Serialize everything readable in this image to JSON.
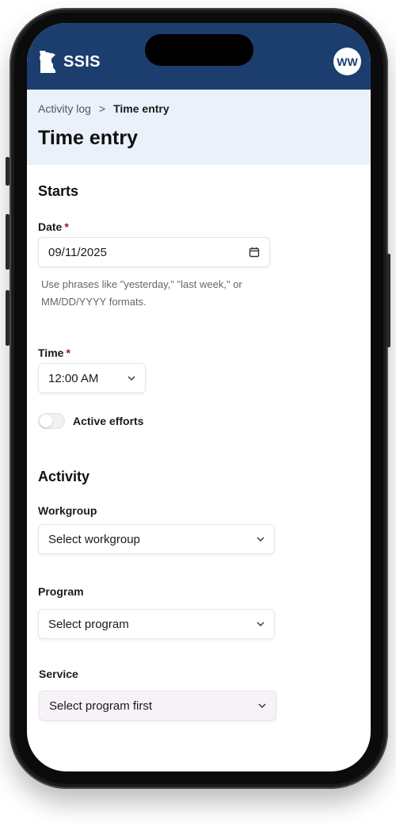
{
  "app": {
    "brand": "SSIS",
    "avatar_initials": "WW",
    "header_color": "#1c3e6e"
  },
  "breadcrumb": {
    "parent": "Activity log",
    "separator": ">",
    "current": "Time entry"
  },
  "page": {
    "title": "Time entry"
  },
  "starts": {
    "title": "Starts",
    "date": {
      "label": "Date",
      "required_mark": "*",
      "value": "09/11/2025",
      "hint": "Use phrases like \"yesterday,\" \"last week,\" or MM/DD/YYYY formats."
    },
    "time": {
      "label": "Time",
      "required_mark": "*",
      "value": "12:00 AM"
    },
    "active_efforts": {
      "label": "Active efforts",
      "on": false
    }
  },
  "activity": {
    "title": "Activity",
    "workgroup": {
      "label": "Workgroup",
      "value": "Select workgroup"
    },
    "program": {
      "label": "Program",
      "value": "Select program"
    },
    "service": {
      "label": "Service",
      "value": "Select program first"
    }
  },
  "icons": {
    "logo": "minnesota-state-icon",
    "date": "calendar-icon",
    "select": "chevron-down-icon"
  }
}
